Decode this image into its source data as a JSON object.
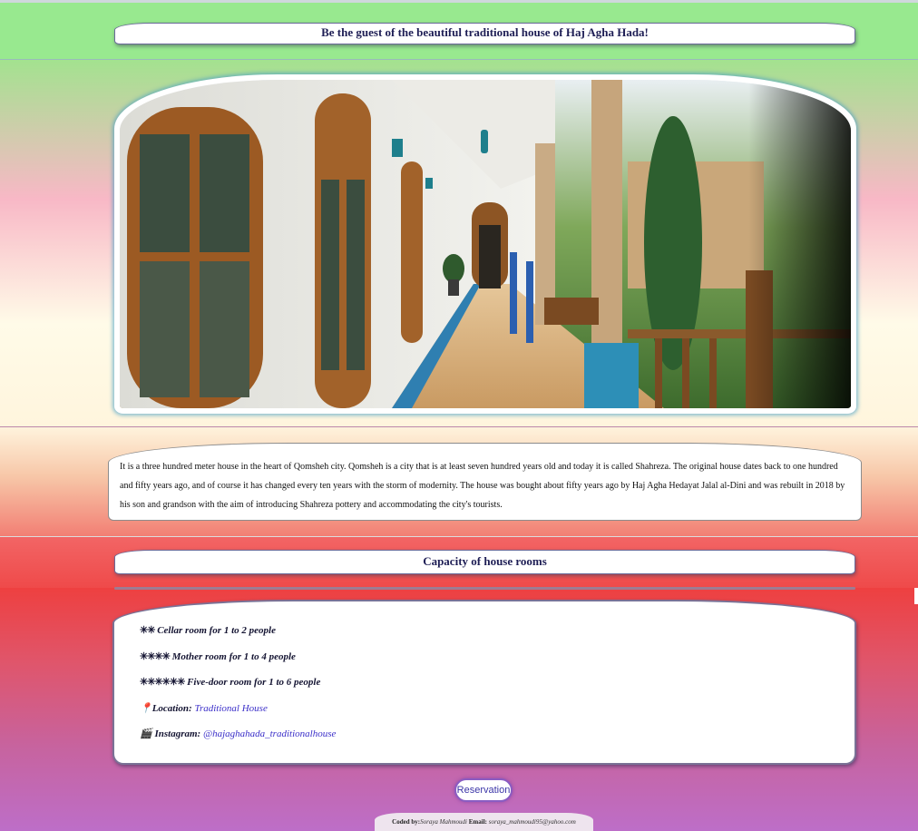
{
  "header": {
    "title": "Be the guest of the beautiful traditional house of Haj Agha Hada!"
  },
  "description": "It is a three hundred meter house in the heart of Qomsheh city. Qomsheh is a city that is at least seven hundred years old and today it is called Shahreza. The original house dates back to one hundred and fifty years ago, and of course it has changed every ten years with the storm of modernity. The house was bought about fifty years ago by Haj Agha Hedayat Jalal al-Dini and was rebuilt in 2018 by his son and grandson with the aim of introducing Shahreza pottery and accommodating the city's tourists.",
  "capacity": {
    "title": "Capacity of house rooms",
    "items": [
      {
        "stars": "✳✳",
        "text": "Cellar room for 1 to 2 people"
      },
      {
        "stars": "✳✳✳✳",
        "text": "Mother room for 1 to 4 people"
      },
      {
        "stars": "✳✳✳✳✳✳",
        "text": "Five-door room for 1 to 6 people"
      }
    ],
    "location": {
      "icon": "📍",
      "label": "Location:",
      "link_text": "Traditional House"
    },
    "instagram": {
      "icon": "🎬",
      "label": "Instagram:",
      "link_text": "@hajaghahada_traditionalhouse"
    }
  },
  "reservation_button": "Reservation",
  "footer": {
    "coded_label": "Coded by:",
    "author": "Soraya Mahmoudi",
    "email_label": " Email:",
    "email": "soraya_mahmoudi95@yahoo.com"
  },
  "colors": {
    "title_text": "#1e1e55",
    "link": "#3b2fc9",
    "band_top": "#98e98f"
  }
}
